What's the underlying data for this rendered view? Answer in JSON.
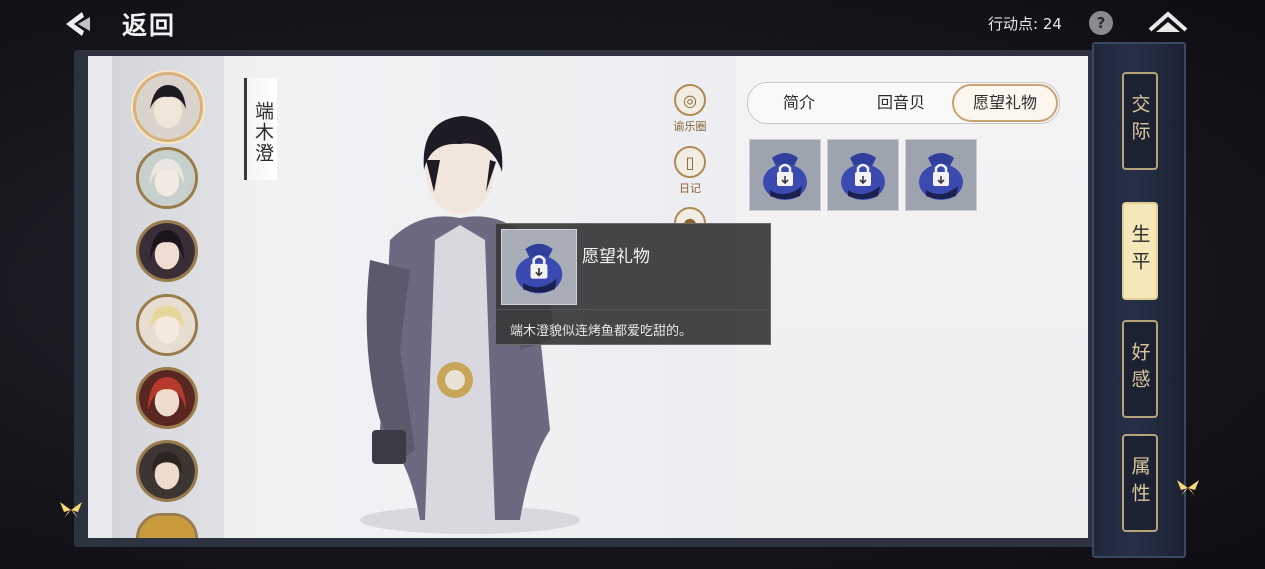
{
  "header": {
    "back_label": "返回",
    "action_points_label": "行动点: 24",
    "help_label": "?"
  },
  "character": {
    "name": "端木澄"
  },
  "side_icons": [
    {
      "label": "谕乐圈",
      "icon": "music-circle-icon"
    },
    {
      "label": "日记",
      "icon": "diary-icon"
    },
    {
      "label": "",
      "icon": "people-icon"
    }
  ],
  "tabs": [
    {
      "label": "简介",
      "active": false
    },
    {
      "label": "回音贝",
      "active": false
    },
    {
      "label": "愿望礼物",
      "active": true
    }
  ],
  "gift_slots": [
    {
      "icon": "locked-gift-bag-icon"
    },
    {
      "icon": "locked-gift-bag-icon"
    },
    {
      "icon": "locked-gift-bag-icon"
    }
  ],
  "tooltip": {
    "title": "愿望礼物",
    "description": "端木澄貌似连烤鱼都爱吃甜的。",
    "icon": "locked-gift-bag-icon"
  },
  "spine_tabs": [
    {
      "label": "交际",
      "active": false
    },
    {
      "label": "生平",
      "active": true
    },
    {
      "label": "好感",
      "active": false
    },
    {
      "label": "属性",
      "active": false
    }
  ],
  "avatars_count": 7,
  "colors": {
    "accent_gold": "#c8a472",
    "spine_navy": "#263048",
    "tooltip_bg": "#3a3a3c"
  }
}
